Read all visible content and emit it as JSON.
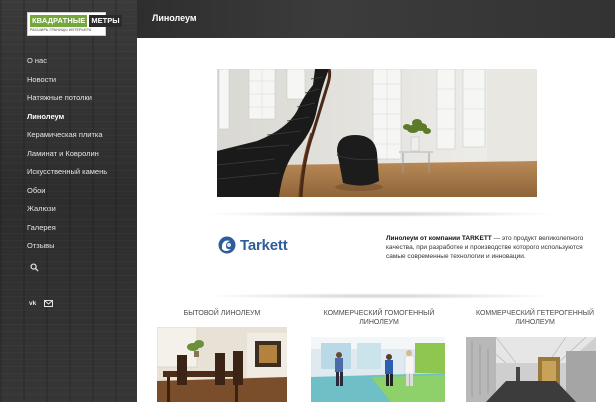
{
  "logo": {
    "word1": "КВАДРАТНЫЕ",
    "word2": "МЕТРЫ",
    "tagline": "РАСШИРЬ ГРАНИЦЫ ИНТЕРЬЕРА"
  },
  "sidebar": {
    "items": [
      {
        "label": "О нас"
      },
      {
        "label": "Новости"
      },
      {
        "label": "Натяжные потолки"
      },
      {
        "label": "Линолеум"
      },
      {
        "label": "Керамическая плитка"
      },
      {
        "label": "Ламинат и Ковролин"
      },
      {
        "label": "Искусственный камень"
      },
      {
        "label": "Обои"
      },
      {
        "label": "Жалюзи"
      },
      {
        "label": "Галерея"
      },
      {
        "label": "Отзывы"
      }
    ],
    "active": "Линолеум",
    "vk_label": "vk"
  },
  "header": {
    "title": "Линолеум"
  },
  "brand": {
    "name": "Tarkett"
  },
  "description": {
    "bold": "Линолеум от компании TARKETT",
    "text": " — это продукт великолепного качества, при разработке и производстве которого используются самые современные технологии и инновации."
  },
  "categories": [
    {
      "title": "БЫТОВОЙ ЛИНОЛЕУМ"
    },
    {
      "title": "КОММЕРЧЕСКИЙ ГОМОГЕННЫЙ ЛИНОЛЕУМ"
    },
    {
      "title": "КОММЕРЧЕСКИЙ ГЕТЕРОГЕННЫЙ ЛИНОЛЕУМ"
    }
  ],
  "colors": {
    "accent": "#74a83a",
    "brand_blue": "#2f5d9c",
    "sidebar_bg": "#333333"
  }
}
